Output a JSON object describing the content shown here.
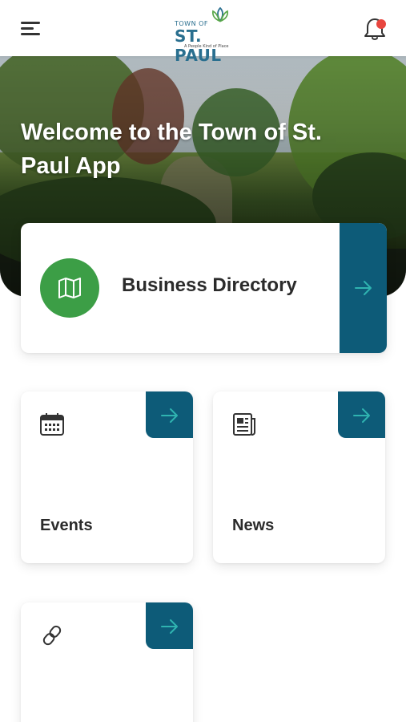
{
  "header": {
    "menu_icon": "hamburger-menu-icon",
    "logo": {
      "town_of": "TOWN OF",
      "name": "ST. PAUL",
      "tagline": "A People Kind of Place"
    },
    "notification_icon": "bell-icon",
    "notification_dot_color": "#e8463f"
  },
  "hero": {
    "title": "Welcome to the Town of St. Paul App"
  },
  "featured_card": {
    "label": "Business Directory",
    "icon": "map-icon",
    "icon_bg_color": "#3c9e46",
    "arrow_icon": "arrow-right-icon"
  },
  "cards": [
    {
      "label": "Events",
      "icon": "calendar-icon",
      "arrow_icon": "arrow-right-icon"
    },
    {
      "label": "News",
      "icon": "newspaper-icon",
      "arrow_icon": "arrow-right-icon"
    },
    {
      "label": "",
      "icon": "link-icon",
      "arrow_icon": "arrow-right-icon"
    }
  ],
  "colors": {
    "accent_panel": "#0d5b78",
    "arrow": "#2fb3b0",
    "brand_text": "#2a6f8f"
  }
}
